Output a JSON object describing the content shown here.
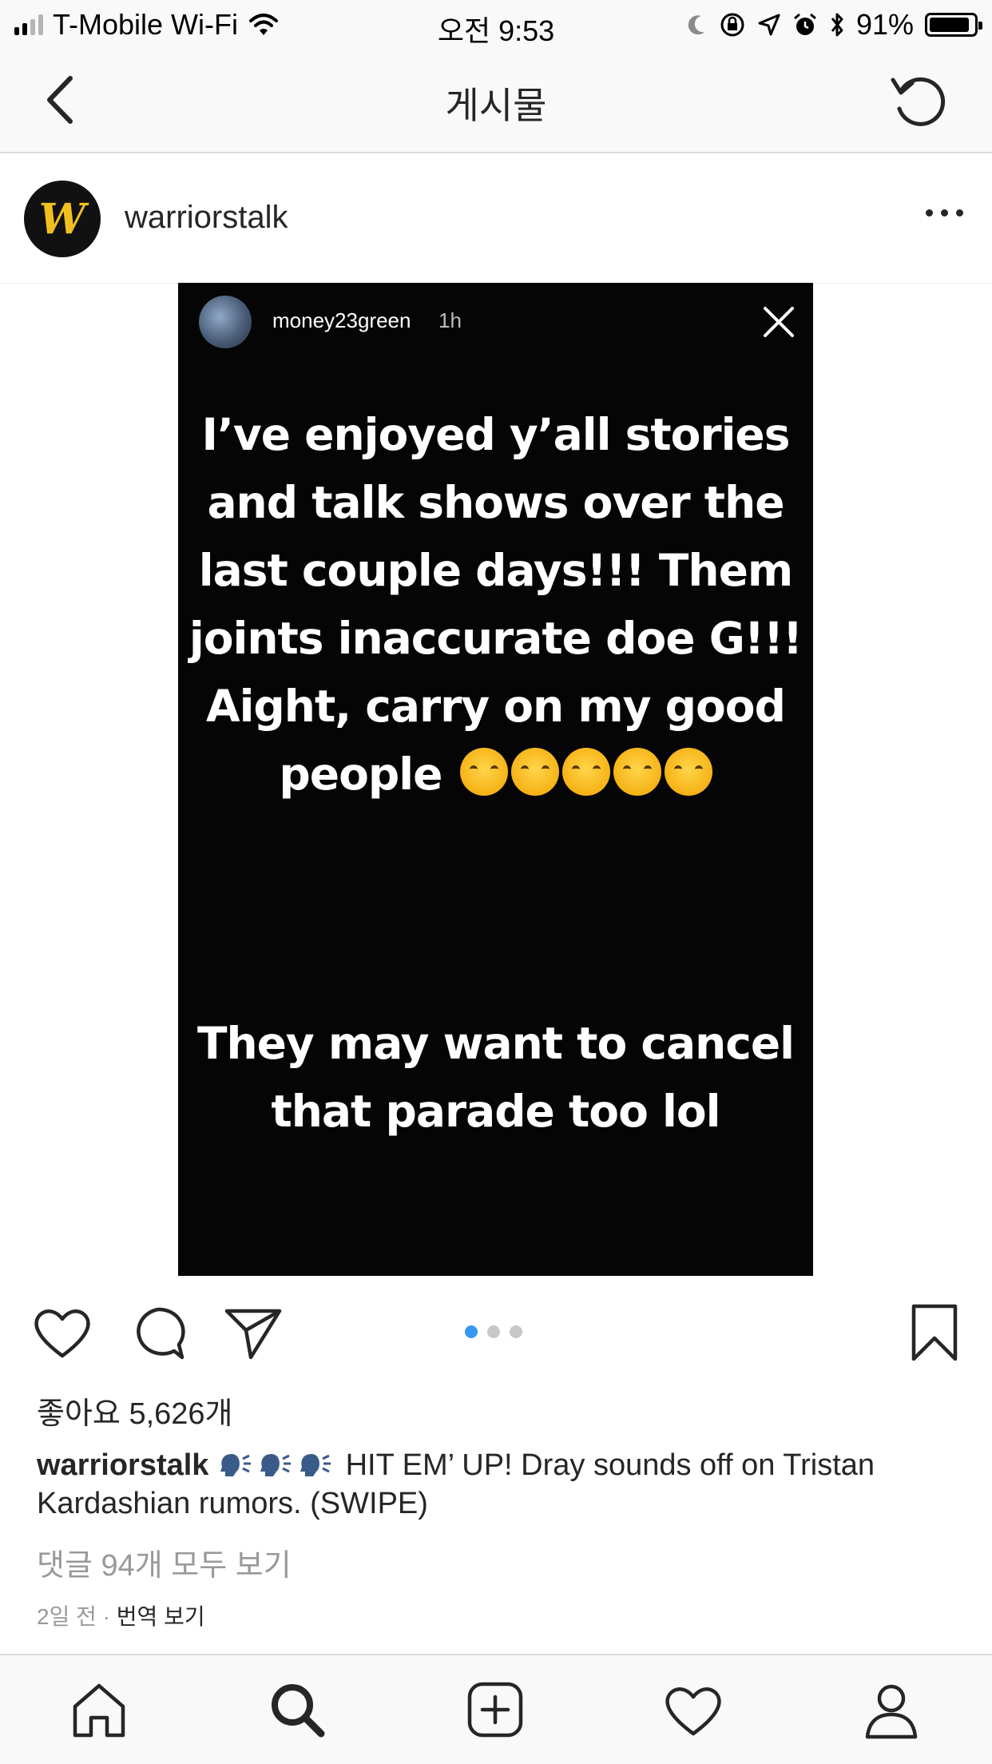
{
  "status_bar": {
    "carrier": "T-Mobile Wi-Fi",
    "time": "오전 9:53",
    "battery": "91%",
    "battery_level": 0.91,
    "signal_bars_filled": 2,
    "signal_bars_total": 4
  },
  "nav": {
    "title": "게시물",
    "back_icon": "chevron-left-icon",
    "refresh_icon": "refresh-icon"
  },
  "post": {
    "username": "warriorstalk",
    "avatar_letter": "W",
    "avatar_color": "#f0c020",
    "more_icon": "more-horizontal-icon"
  },
  "story": {
    "username": "money23green",
    "time": "1h",
    "text_1": "I’ve enjoyed y’all stories and talk shows over the last couple days!!! Them joints inaccurate doe G!!! Aight, carry on my good people",
    "emoji_count": 5,
    "text_2": "They may want to cancel that parade too lol"
  },
  "actions": {
    "like_icon": "heart-icon",
    "comment_icon": "comment-icon",
    "share_icon": "send-icon",
    "save_icon": "bookmark-icon",
    "carousel_pages": 3,
    "carousel_active": 1,
    "accent_color": "#3897f0"
  },
  "likes": "좋아요 5,626개",
  "caption": {
    "username": "warriorstalk",
    "text": "HIT EM’ UP! Dray sounds off on Tristan Kardashian rumors. (SWIPE)"
  },
  "comments_link": "댓글 94개 모두 보기",
  "meta": {
    "time": "2일 전",
    "separator": "·",
    "translate": "번역 보기"
  },
  "tab_bar": [
    "home-icon",
    "search-icon",
    "add-post-icon",
    "activity-heart-icon",
    "profile-icon"
  ]
}
